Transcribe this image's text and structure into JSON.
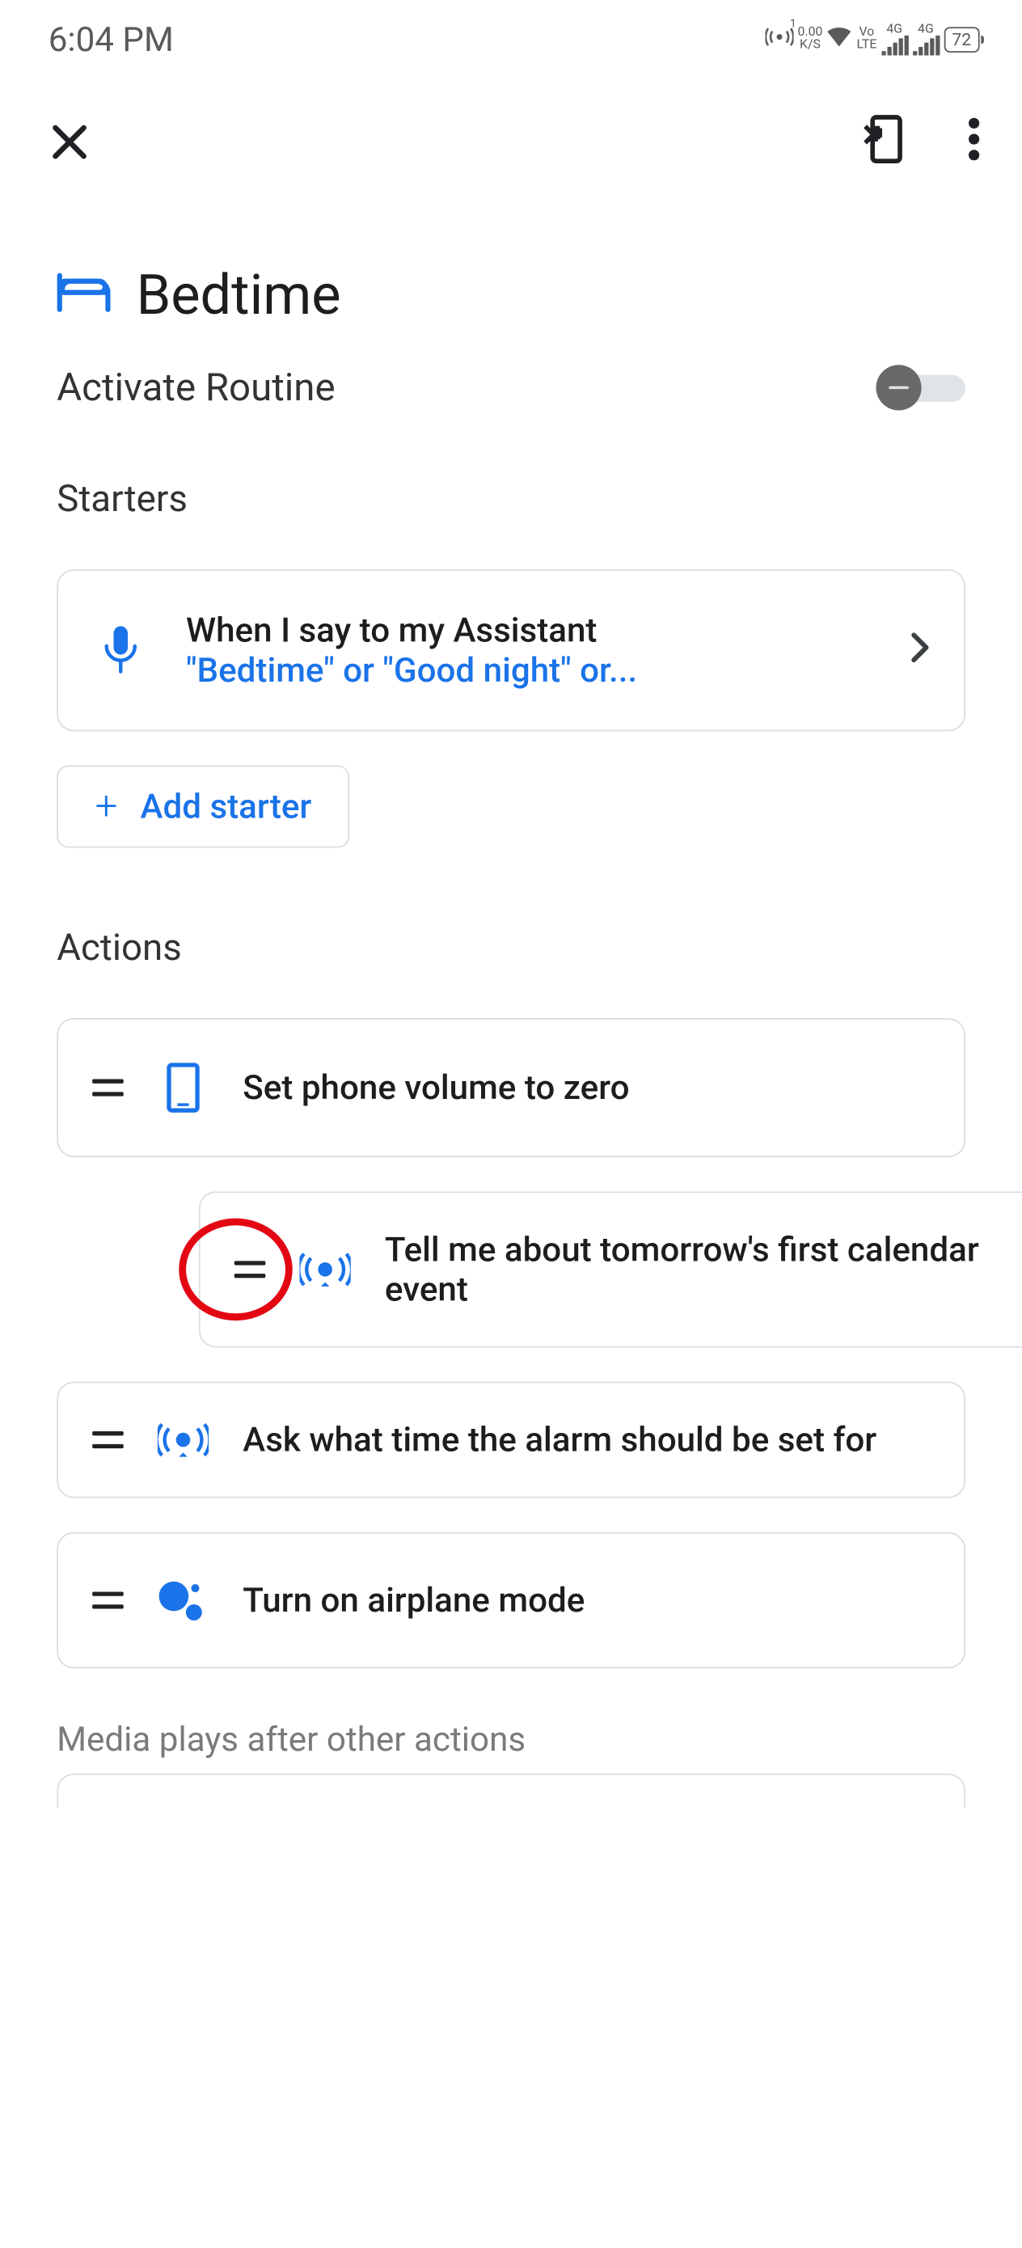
{
  "status_bar": {
    "time": "6:04 PM",
    "data_rate_top": "0.00",
    "data_rate_bottom": "K/S",
    "vo": "Vo",
    "lte": "LTE",
    "sig1_label": "4G",
    "sig2_label": "4G",
    "battery": "72",
    "hotspot_badge": "1"
  },
  "page": {
    "title": "Bedtime",
    "activate_label": "Activate Routine"
  },
  "starters": {
    "section_label": "Starters",
    "card": {
      "title": "When I say to my Assistant",
      "subtitle": "\"Bedtime\" or \"Good night\" or..."
    },
    "add_label": "Add starter"
  },
  "actions": {
    "section_label": "Actions",
    "items": [
      {
        "text": "Set phone volume to zero"
      },
      {
        "text": "Tell me about tomorrow's first calendar event"
      },
      {
        "text": "Ask what time the alarm should be set for"
      },
      {
        "text": "Turn on airplane mode"
      }
    ]
  },
  "media": {
    "label": "Media plays after other actions"
  }
}
